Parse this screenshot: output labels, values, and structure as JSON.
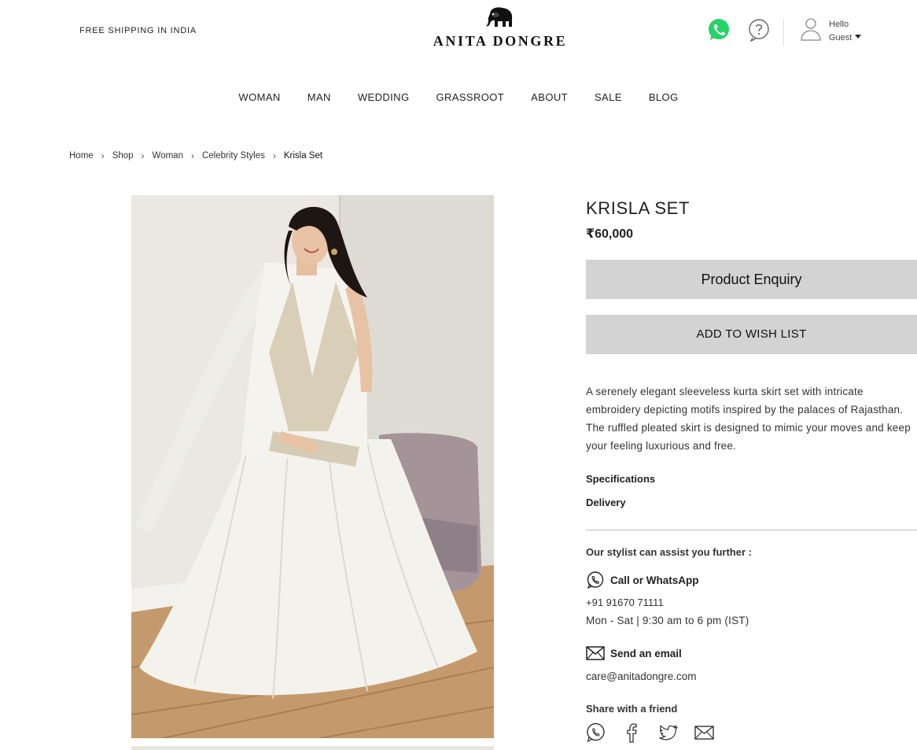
{
  "header": {
    "shipping_text": "FREE SHIPPING IN INDIA",
    "brand": "ANITA DONGRE",
    "user_greeting": "Hello",
    "user_name": "Guest"
  },
  "nav": {
    "items": [
      "WOMAN",
      "MAN",
      "WEDDING",
      "GRASSROOT",
      "ABOUT",
      "SALE",
      "BLOG"
    ]
  },
  "breadcrumb": {
    "items": [
      "Home",
      "Shop",
      "Woman",
      "Celebrity Styles",
      "Krisla Set"
    ]
  },
  "product": {
    "title": "KRISLA SET",
    "price": "₹60,000",
    "enquiry_label": "Product Enquiry",
    "wishlist_label": "ADD TO WISH LIST",
    "description": "A serenely elegant sleeveless kurta skirt set with intricate embroidery depicting motifs inspired by the palaces of Rajasthan. The ruffled pleated skirt is designed to mimic your moves and keep your feeling luxurious and free.",
    "specifications_label": "Specifications",
    "delivery_label": "Delivery"
  },
  "contact": {
    "stylist_text": "Our stylist can assist you further :",
    "call_label": "Call or WhatsApp",
    "phone": "+91 91670 71111",
    "hours": "Mon - Sat | 9:30 am to 6 pm (IST)",
    "email_label": "Send an email",
    "email": "care@anitadongre.com",
    "share_label": "Share with a friend"
  },
  "icons": {
    "header": [
      "elephant-logo-icon",
      "whatsapp-icon",
      "help-icon",
      "user-icon",
      "chevron-down-icon"
    ],
    "share": [
      "whatsapp-icon",
      "facebook-icon",
      "twitter-icon",
      "mail-icon"
    ]
  },
  "colors": {
    "whatsapp_green": "#25D366",
    "button_gray": "#d3d3d3",
    "text_dark": "#222222"
  }
}
